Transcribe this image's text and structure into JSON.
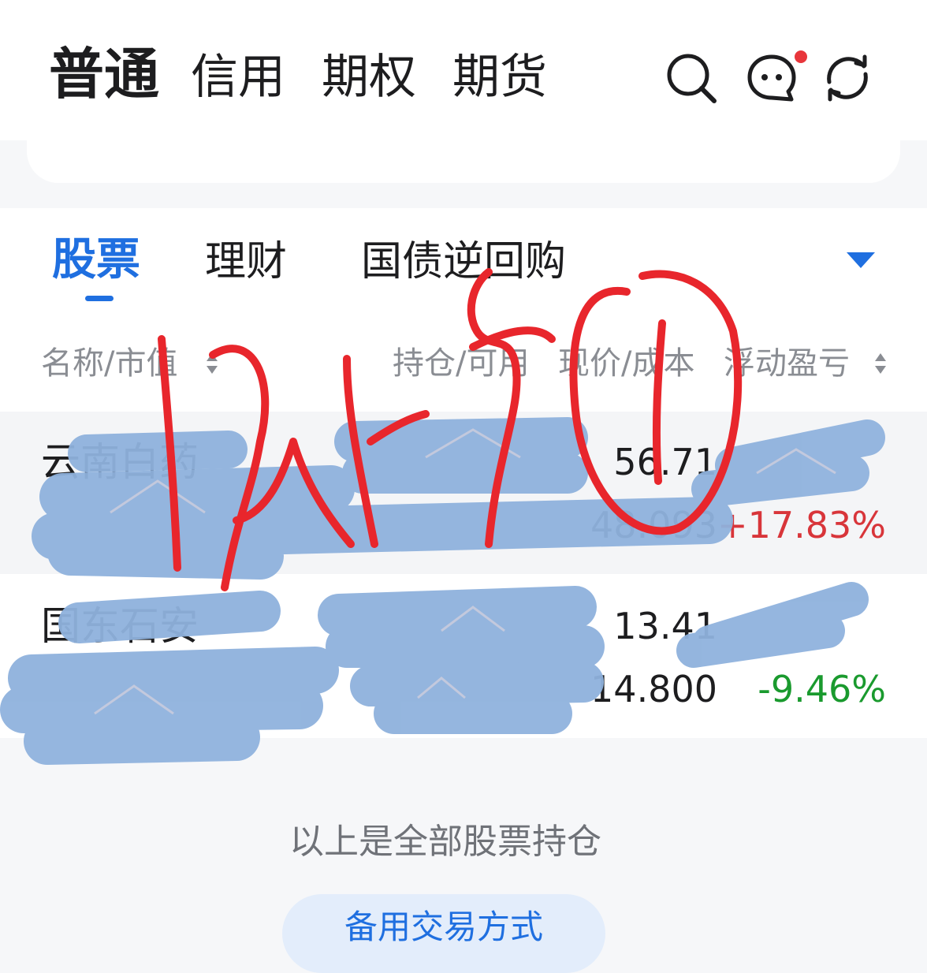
{
  "account_tabs": [
    {
      "label": "普通",
      "active": true
    },
    {
      "label": "信用",
      "active": false
    },
    {
      "label": "期权",
      "active": false
    },
    {
      "label": "期货",
      "active": false
    }
  ],
  "toolbar_icons": [
    "search-icon",
    "message-icon",
    "refresh-icon"
  ],
  "asset_tabs": [
    {
      "label": "股票",
      "active": true
    },
    {
      "label": "理财",
      "active": false
    },
    {
      "label": "国债逆回购",
      "active": false
    }
  ],
  "columns": {
    "name_value": "名称/市值",
    "position_available": "持仓/可用",
    "price_cost": "现价/成本",
    "float_pl": "浮动盈亏"
  },
  "holdings": [
    {
      "name": "云南白药",
      "price": "56.71",
      "cost": "48.093",
      "pl_percent": "+17.83%"
    },
    {
      "name": "国东石安",
      "price": "13.41",
      "cost": "14.800",
      "pl_percent": "-9.46%"
    }
  ],
  "footer_note": "以上是全部股票持仓",
  "backup_trade_button": "备用交易方式",
  "colors": {
    "accent": "#1f6fe0",
    "gain": "#d8353a",
    "loss": "#1a9a2e",
    "scribble_red": "#e8262c",
    "redaction_blue": "#8fb2dd"
  }
}
